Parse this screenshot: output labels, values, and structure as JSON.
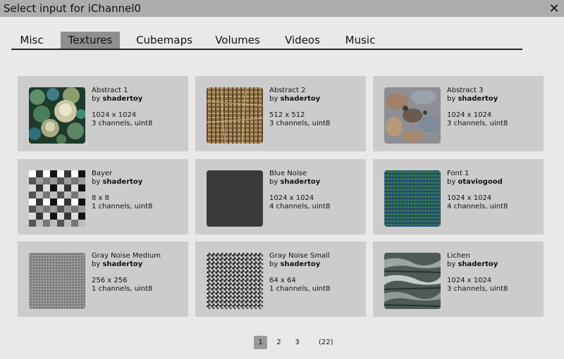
{
  "window": {
    "title": "Select input for iChannel0",
    "close_glyph": "✕"
  },
  "tabs": [
    {
      "label": "Misc",
      "active": false
    },
    {
      "label": "Textures",
      "active": true
    },
    {
      "label": "Cubemaps",
      "active": false
    },
    {
      "label": "Volumes",
      "active": false
    },
    {
      "label": "Videos",
      "active": false
    },
    {
      "label": "Music",
      "active": false
    }
  ],
  "textures": [
    {
      "name": "Abstract 1",
      "by": "by",
      "author": "shadertoy",
      "size": "1024 x 1024",
      "format": "3 channels, uint8",
      "icon": "abstract-pebbles-thumbnail"
    },
    {
      "name": "Abstract 2",
      "by": "by",
      "author": "shadertoy",
      "size": "512 x 512",
      "format": "3 channels, uint8",
      "icon": "woven-fabric-thumbnail"
    },
    {
      "name": "Abstract 3",
      "by": "by",
      "author": "shadertoy",
      "size": "1024 x 1024",
      "format": "3 channels, uint8",
      "icon": "rocky-surface-thumbnail"
    },
    {
      "name": "Bayer",
      "by": "by",
      "author": "shadertoy",
      "size": "8 x 8",
      "format": "1 channels, uint8",
      "icon": "bayer-matrix-thumbnail"
    },
    {
      "name": "Blue Noise",
      "by": "by",
      "author": "shadertoy",
      "size": "1024 x 1024",
      "format": "4 channels, uint8",
      "icon": "blue-noise-thumbnail"
    },
    {
      "name": "Font 1",
      "by": "by",
      "author": "otaviogood",
      "size": "1024 x 1024",
      "format": "4 channels, uint8",
      "icon": "font-atlas-thumbnail"
    },
    {
      "name": "Gray Noise Medium",
      "by": "by",
      "author": "shadertoy",
      "size": "256 x 256",
      "format": "1 channels, uint8",
      "icon": "gray-noise-medium-thumbnail"
    },
    {
      "name": "Gray Noise Small",
      "by": "by",
      "author": "shadertoy",
      "size": "64 x 64",
      "format": "1 channels, uint8",
      "icon": "gray-noise-small-thumbnail"
    },
    {
      "name": "Lichen",
      "by": "by",
      "author": "shadertoy",
      "size": "1024 x 1024",
      "format": "3 channels, uint8",
      "icon": "lichen-thumbnail"
    }
  ],
  "pagination": {
    "pages": [
      "1",
      "2",
      "3"
    ],
    "current": "1",
    "total": "(22)"
  }
}
